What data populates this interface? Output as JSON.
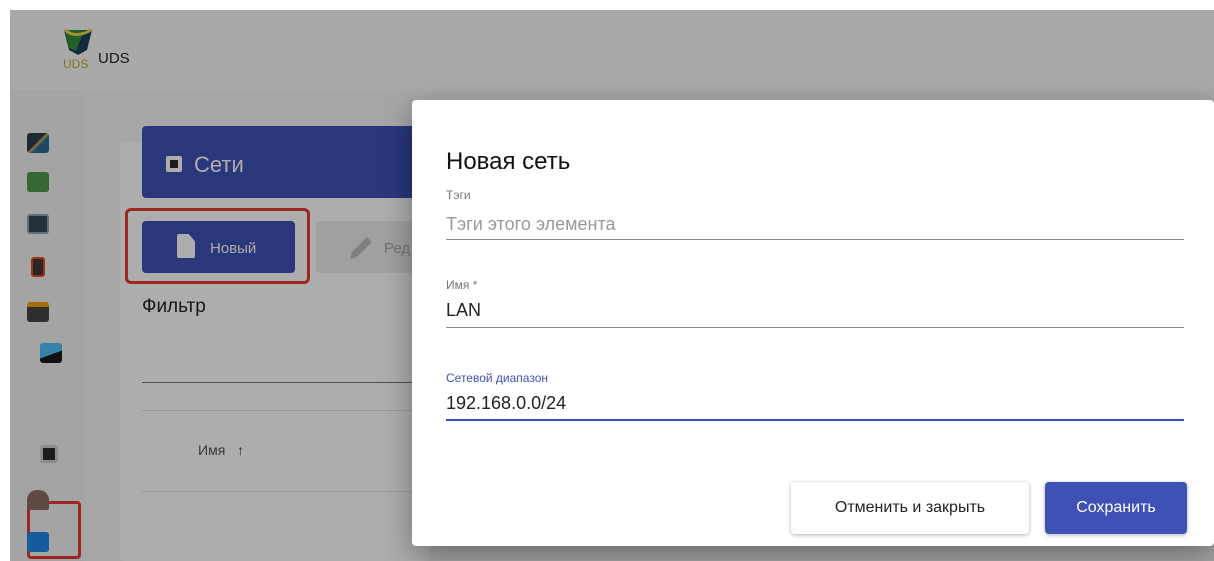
{
  "app": {
    "title": "UDS",
    "logo_text": "UDS"
  },
  "sidebar": {
    "items": [
      {
        "icon": "dashboard-icon"
      },
      {
        "icon": "services-icon"
      },
      {
        "icon": "authenticators-icon"
      },
      {
        "icon": "os-managers-icon"
      },
      {
        "icon": "transports-icon"
      },
      {
        "icon": "services-pools-icon"
      },
      {
        "icon": "networks-icon",
        "selected": true
      },
      {
        "icon": "gallery-icon"
      },
      {
        "icon": "calendar-icon"
      }
    ]
  },
  "page": {
    "header_title": "Сети",
    "toolbar": {
      "new_label": "Новый",
      "edit_label": "Ред"
    },
    "filter_label": "Фильтр",
    "table": {
      "column_name": "Имя"
    }
  },
  "dialog": {
    "title": "Новая сеть",
    "tags": {
      "label": "Тэги",
      "placeholder": "Тэги этого элемента",
      "value": ""
    },
    "name": {
      "label": "Имя *",
      "value": "LAN"
    },
    "range": {
      "label": "Сетевой диапазон",
      "value": "192.168.0.0/24"
    },
    "cancel_label": "Отменить и закрыть",
    "save_label": "Сохранить"
  },
  "colors": {
    "primary": "#3f51b5",
    "highlight": "#e53935"
  }
}
